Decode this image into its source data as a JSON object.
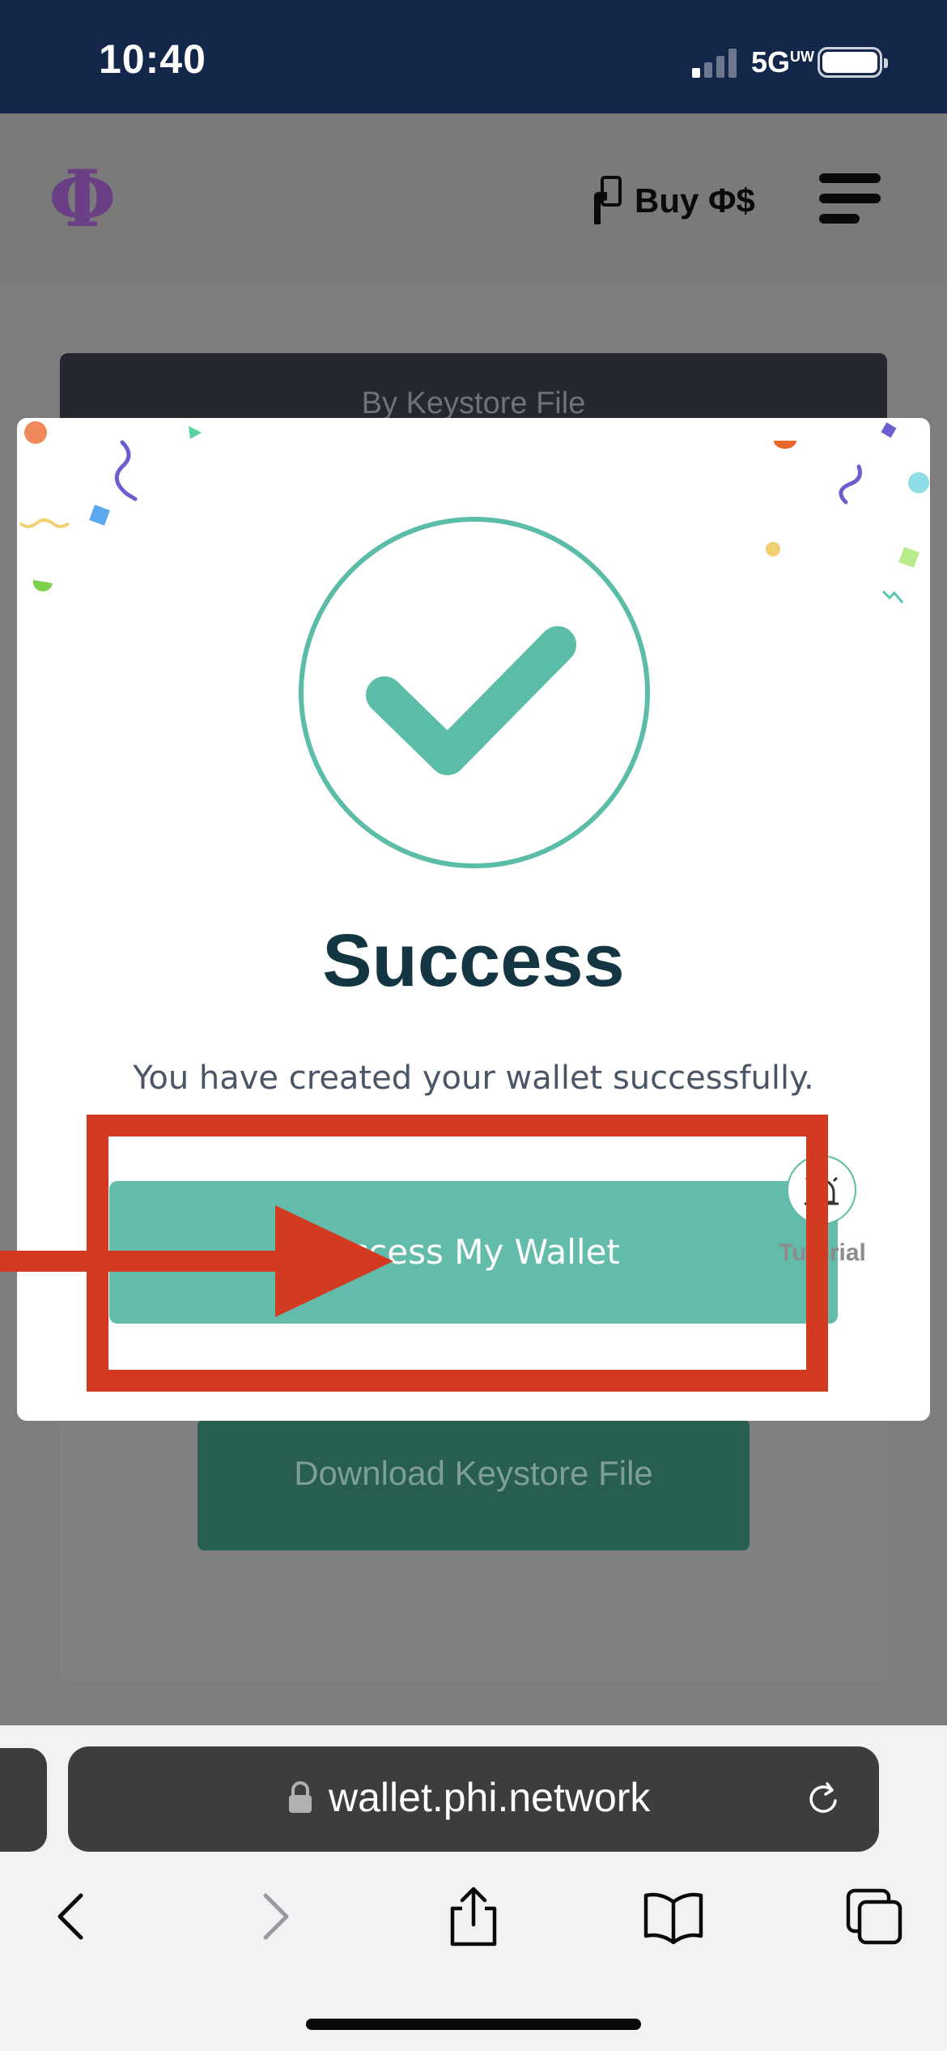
{
  "status_bar": {
    "time": "10:40",
    "network": "5G",
    "network_superscript": "UW",
    "signal_bars_active": 1,
    "signal_bars_total": 4
  },
  "header": {
    "logo_glyph": "Φ",
    "buy_label": "Buy Φ$",
    "icons": [
      "wallet-card-icon",
      "hamburger-menu-icon"
    ]
  },
  "background_page": {
    "tab_label": "By Keystore File",
    "download_button_label": "Download Keystore File"
  },
  "modal": {
    "title": "Success",
    "message": "You have created your wallet successfully.",
    "primary_button_label": "Access My Wallet",
    "tutorial_label": "Tutorial",
    "icons": [
      "checkmark-circle-icon",
      "confetti-decoration",
      "bell-icon"
    ]
  },
  "annotation": {
    "color": "#d23a22",
    "type": "arrow-and-box-highlight"
  },
  "browser": {
    "url": "wallet.phi.network",
    "toolbar_icons": [
      "back-icon",
      "forward-icon",
      "share-icon",
      "bookmarks-icon",
      "tabs-icon"
    ]
  },
  "colors": {
    "accent": "#5bbca8",
    "status_bar_bg": "#13274a",
    "title_text": "#143642"
  }
}
